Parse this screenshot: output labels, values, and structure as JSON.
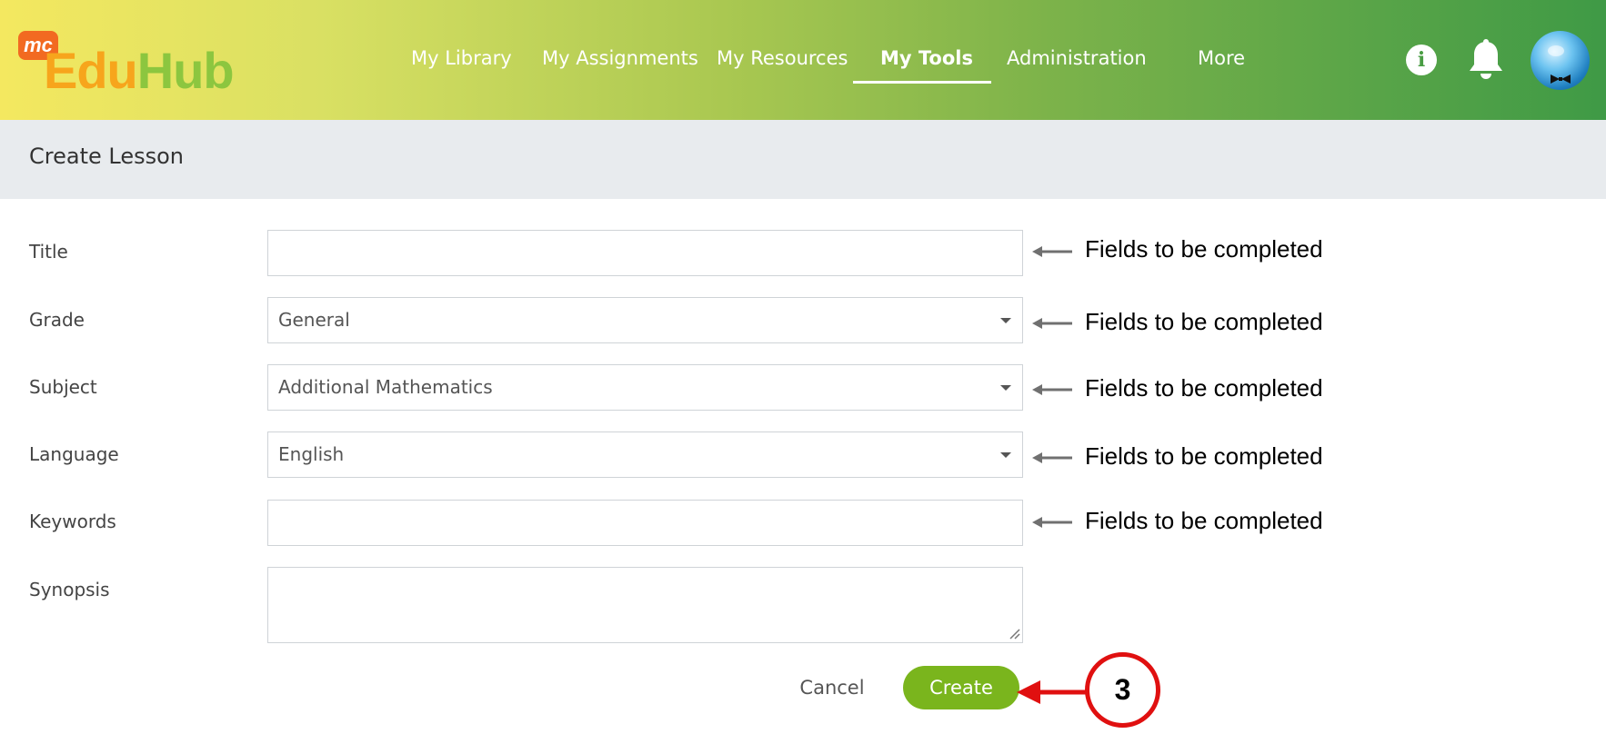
{
  "app": {
    "logo_badge": "mc",
    "logo_edu": "Edu",
    "logo_hub": "Hub"
  },
  "nav": {
    "items": [
      {
        "label": "My Library"
      },
      {
        "label": "My Assignments"
      },
      {
        "label": "My Resources"
      },
      {
        "label": "My Tools",
        "active": true
      },
      {
        "label": "Administration"
      },
      {
        "label": "More"
      }
    ]
  },
  "header": {
    "info_glyph": "i",
    "icons": [
      "info-icon",
      "bell-icon",
      "avatar"
    ]
  },
  "page": {
    "title": "Create Lesson"
  },
  "form": {
    "title_label": "Title",
    "title_value": "",
    "grade_label": "Grade",
    "grade_value": "General",
    "subject_label": "Subject",
    "subject_value": "Additional Mathematics",
    "language_label": "Language",
    "language_value": "English",
    "keywords_label": "Keywords",
    "keywords_value": "",
    "synopsis_label": "Synopsis",
    "synopsis_value": "",
    "cancel_label": "Cancel",
    "create_label": "Create"
  },
  "annotations": {
    "field_note": "Fields to be completed",
    "step_number": "3",
    "colors": {
      "step": "#e01010",
      "create": "#7ab51d",
      "arrow": "#707070"
    }
  }
}
